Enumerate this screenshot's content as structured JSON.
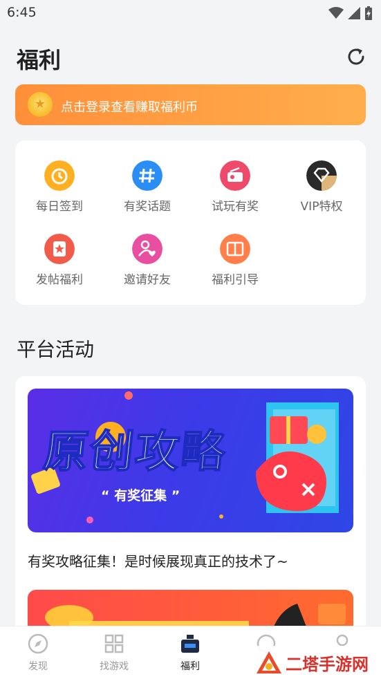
{
  "status": {
    "time": "6:45"
  },
  "header": {
    "title": "福利"
  },
  "login_banner": {
    "text": "点击登录查看赚取福利币"
  },
  "grid": [
    {
      "label": "每日签到",
      "icon": "daily-checkin-icon"
    },
    {
      "label": "有奖话题",
      "icon": "hashtag-icon"
    },
    {
      "label": "试玩有奖",
      "icon": "radio-icon"
    },
    {
      "label": "VIP特权",
      "icon": "diamond-icon"
    },
    {
      "label": "发帖福利",
      "icon": "post-icon"
    },
    {
      "label": "邀请好友",
      "icon": "invite-icon"
    },
    {
      "label": "福利引导",
      "icon": "book-icon"
    }
  ],
  "section": {
    "title": "平台活动"
  },
  "activity": {
    "banner_title": "原创攻略",
    "banner_subtitle": "有奖征集",
    "text": "有奖攻略征集！是时候展现真正的技术了~"
  },
  "tabbar": [
    {
      "label": "发现",
      "icon": "compass-icon"
    },
    {
      "label": "找游戏",
      "icon": "grid-icon"
    },
    {
      "label": "福利",
      "icon": "welfare-icon"
    },
    {
      "label": "",
      "icon": "game-icon"
    },
    {
      "label": "",
      "icon": "user-icon"
    }
  ],
  "watermark": {
    "text": "二塔手游网"
  },
  "colors": {
    "accent": "#ff9a3c",
    "active_tab": "#222222"
  }
}
